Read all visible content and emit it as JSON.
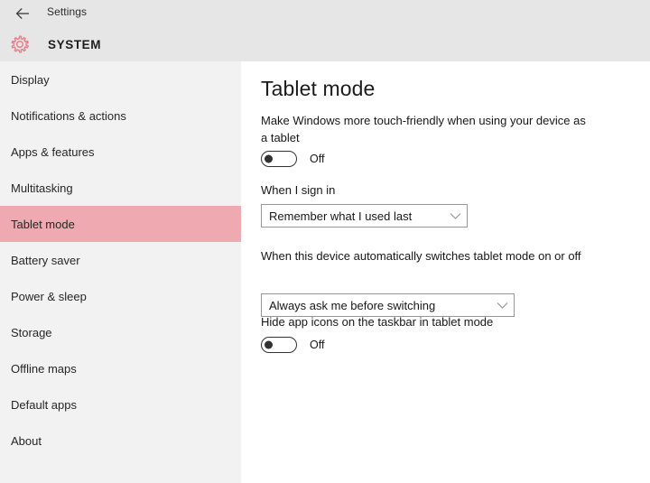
{
  "header": {
    "back_icon": "back-arrow-icon",
    "settings_label": "Settings",
    "gear_icon": "gear-icon",
    "category_title": "SYSTEM",
    "accent_color": "#e8818c",
    "bar_color": "#e6e6e6"
  },
  "sidebar": {
    "background_color": "#f2f2f2",
    "selected_color": "#eeaab0",
    "items": [
      {
        "label": "Display",
        "selected": false
      },
      {
        "label": "Notifications & actions",
        "selected": false
      },
      {
        "label": "Apps & features",
        "selected": false
      },
      {
        "label": "Multitasking",
        "selected": false
      },
      {
        "label": "Tablet mode",
        "selected": true
      },
      {
        "label": "Battery saver",
        "selected": false
      },
      {
        "label": "Power & sleep",
        "selected": false
      },
      {
        "label": "Storage",
        "selected": false
      },
      {
        "label": "Offline maps",
        "selected": false
      },
      {
        "label": "Default apps",
        "selected": false
      },
      {
        "label": "About",
        "selected": false
      }
    ]
  },
  "main": {
    "title": "Tablet mode",
    "tablet_mode": {
      "description": "Make Windows more touch-friendly when using your device as a tablet",
      "toggle_state": "Off"
    },
    "sign_in": {
      "label": "When I sign in",
      "selected_option": "Remember what I used last",
      "chevron_icon": "chevron-down-icon"
    },
    "auto_switch": {
      "label": "When this device automatically switches tablet mode on or off",
      "selected_option": "Always ask me before switching",
      "chevron_icon": "chevron-down-icon"
    },
    "hide_app_icons": {
      "label": "Hide app icons on the taskbar in tablet mode",
      "toggle_state": "Off"
    }
  }
}
